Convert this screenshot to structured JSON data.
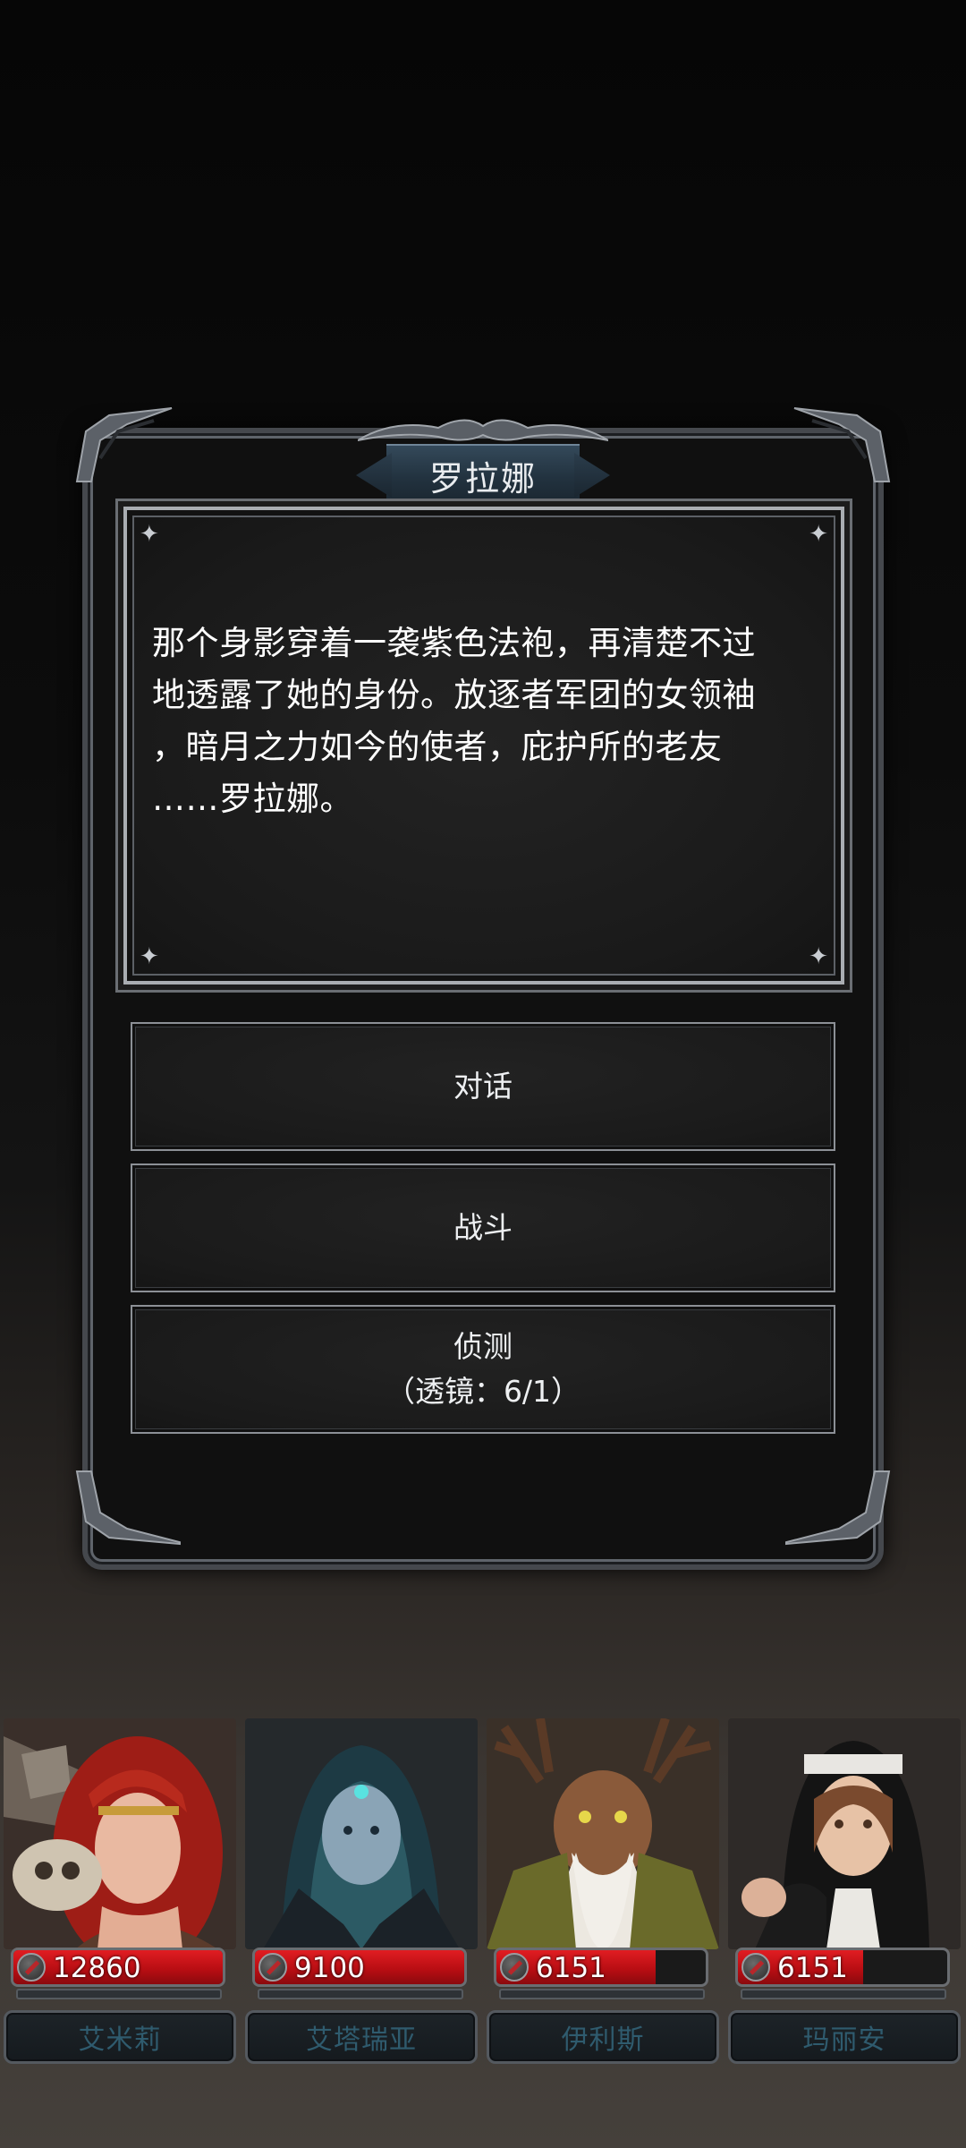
{
  "dialog": {
    "title": "罗拉娜",
    "text_lines": [
      "那个身影穿着一袭紫色法袍，再清楚不过",
      "地透露了她的身份。放逐者军团的女领袖",
      "，暗月之力如今的使者，庇护所的老友",
      "……罗拉娜。"
    ],
    "options": {
      "talk": "对话",
      "fight": "战斗",
      "detect": "侦测",
      "detect_cost": "（透镜：6/1）"
    }
  },
  "party": [
    {
      "name": "艾米莉",
      "hp": "12860",
      "hp_fraction": 1.0
    },
    {
      "name": "艾塔瑞亚",
      "hp": "9100",
      "hp_fraction": 1.0
    },
    {
      "name": "伊利斯",
      "hp": "6151",
      "hp_fraction": 0.76
    },
    {
      "name": "玛丽安",
      "hp": "6151",
      "hp_fraction": 0.6
    }
  ],
  "colors": {
    "hp_red": "#c4151a",
    "name_text": "#2f5b6e",
    "title_banner": "#2a3c4b"
  }
}
